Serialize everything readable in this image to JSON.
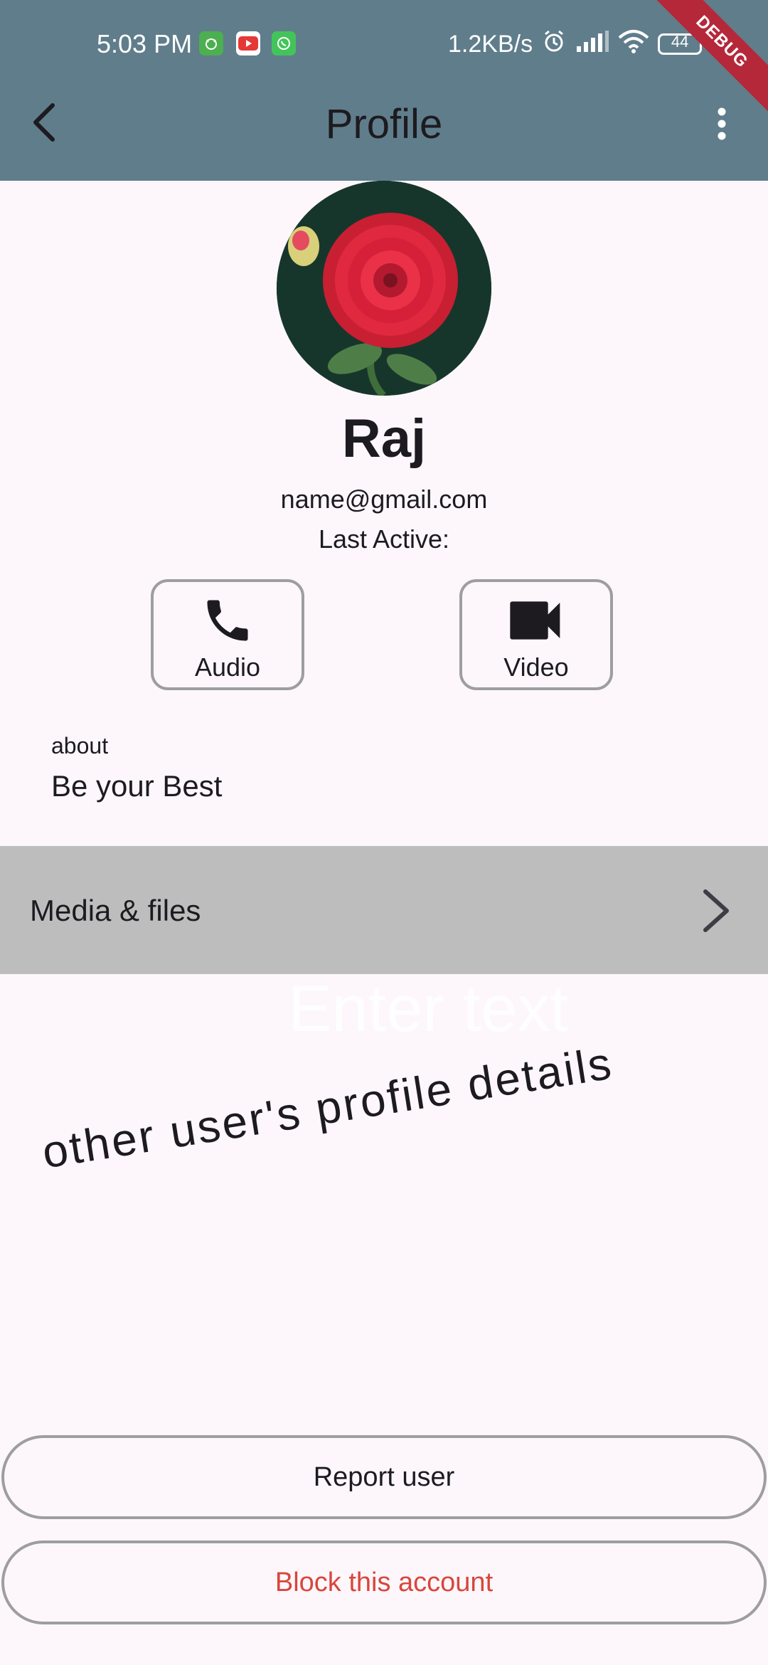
{
  "status_bar": {
    "time": "5:03 PM",
    "network_speed": "1.2KB/s",
    "battery": "44",
    "debug_banner": "DEBUG",
    "notification_icons": [
      "cat-app-icon",
      "youtube-icon",
      "whatsapp-icon"
    ]
  },
  "app_bar": {
    "title": "Profile",
    "background": "#607d8b"
  },
  "profile": {
    "name": "Raj",
    "email": "name@gmail.com",
    "last_active": "Last Active:",
    "audio_label": "Audio",
    "video_label": "Video",
    "about_label": "about",
    "about_value": "Be your Best"
  },
  "media": {
    "label": "Media & files"
  },
  "input": {
    "placeholder": "Enter text"
  },
  "note": {
    "text": "other user's profile details"
  },
  "actions": {
    "report_label": "Report user",
    "block_label": "Block this account",
    "block_color": "#d9463b"
  }
}
